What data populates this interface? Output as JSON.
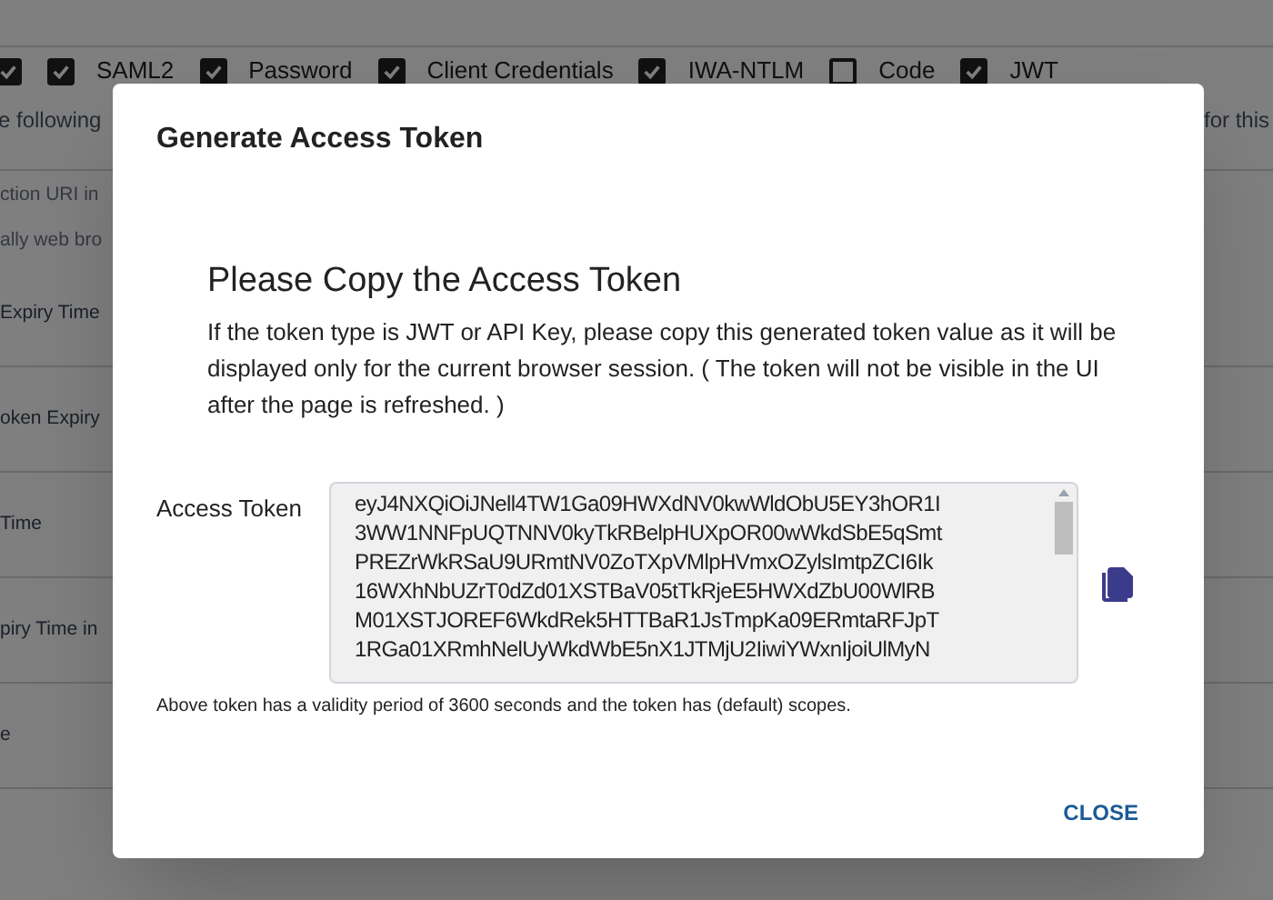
{
  "background": {
    "grant_types": [
      {
        "checked": true
      },
      {
        "label": "SAML2",
        "checked": true
      },
      {
        "label": "Password",
        "checked": true
      },
      {
        "label": "Client Credentials",
        "checked": true
      },
      {
        "label": "IWA-NTLM",
        "checked": true
      },
      {
        "label": "Code",
        "checked": false
      },
      {
        "label": "JWT",
        "checked": true
      }
    ],
    "hint_left": "e following",
    "hint_right": "for this",
    "side_texts": [
      "ction URI in",
      "ally web bro",
      "Expiry Time",
      "oken Expiry",
      "Time",
      "piry Time in",
      "e"
    ]
  },
  "dialog": {
    "title": "Generate Access Token",
    "heading": "Please Copy the Access Token",
    "message": "If the token type is JWT or API Key, please copy this generated token value as it will be displayed only for the current browser session. ( The token will not be visible in the UI after the page is refreshed. )",
    "token_label": "Access Token",
    "token_lines": [
      "eyJ4NXQiOiJNell4TW1Ga09HWXdNV0kwWldObU5EY3hOR1I",
      "3WW1NNFpUQTNNV0kyTkRBelpHUXpOR00wWkdSbE5qSmt",
      "PREZrWkRSaU9URmtNV0ZoTXpVMlpHVmxOZylsImtpZCI6Ik",
      "16WXhNbUZrT0dZd01XSTBaV05tTkRjeE5HWXdZbU00WlRB",
      "M01XSTJOREF6WkdRek5HTTBaR1JsTmpKa09ERmtaRFJpT",
      "1RGa01XRmhNelUyWkdWbE5nX1JTMjU2IiwiYWxnIjoiUlMyN"
    ],
    "note": "Above token has a validity period of 3600 seconds and the token has (default) scopes.",
    "close": "CLOSE"
  }
}
